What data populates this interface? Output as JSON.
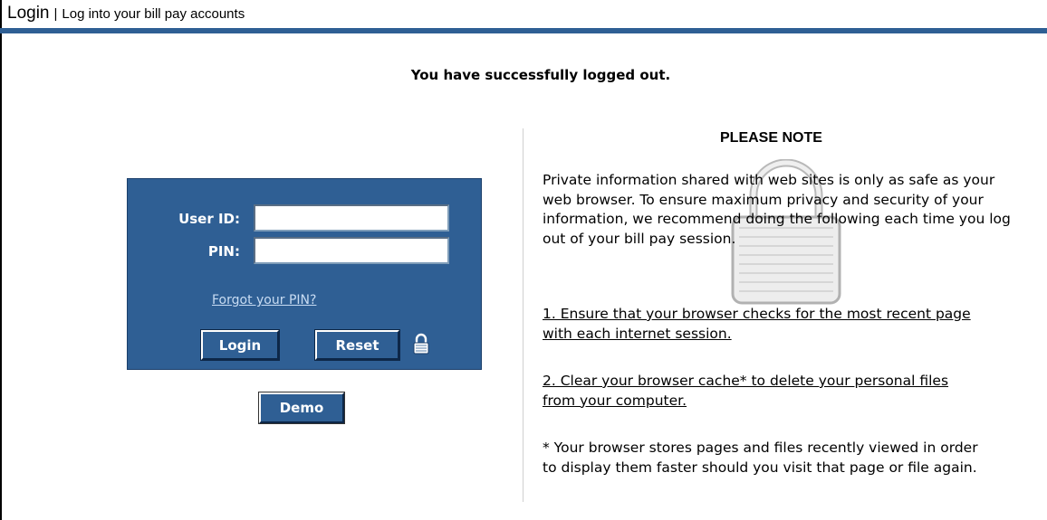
{
  "header": {
    "title": "Login",
    "separator": "|",
    "subtitle": "Log into your bill pay accounts"
  },
  "status": {
    "message": "You have successfully logged out."
  },
  "login_form": {
    "user_id_label": "User ID:",
    "user_id_value": "",
    "pin_label": "PIN:",
    "pin_value": "",
    "forgot_link": "Forgot your PIN?",
    "login_button": "Login",
    "reset_button": "Reset",
    "lock_icon": "padlock-icon"
  },
  "demo": {
    "button_label": "Demo"
  },
  "note": {
    "heading": "PLEASE NOTE",
    "intro": "Private information shared with web sites is only as safe as your web browser. To ensure maximum privacy and security of your information, we recommend doing the following each time you log out of your bill pay session.",
    "step1": "1. Ensure that your browser checks for the most recent page with each internet session.",
    "step2": "2. Clear your browser cache* to delete your personal files from your computer.",
    "footnote": "* Your browser stores pages and files recently viewed in order to display them faster should you visit that page or file again.",
    "watermark_icon": "padlock-watermark-icon"
  },
  "colors": {
    "brand_blue": "#2f5f94",
    "link_color": "#c8dcf3"
  }
}
